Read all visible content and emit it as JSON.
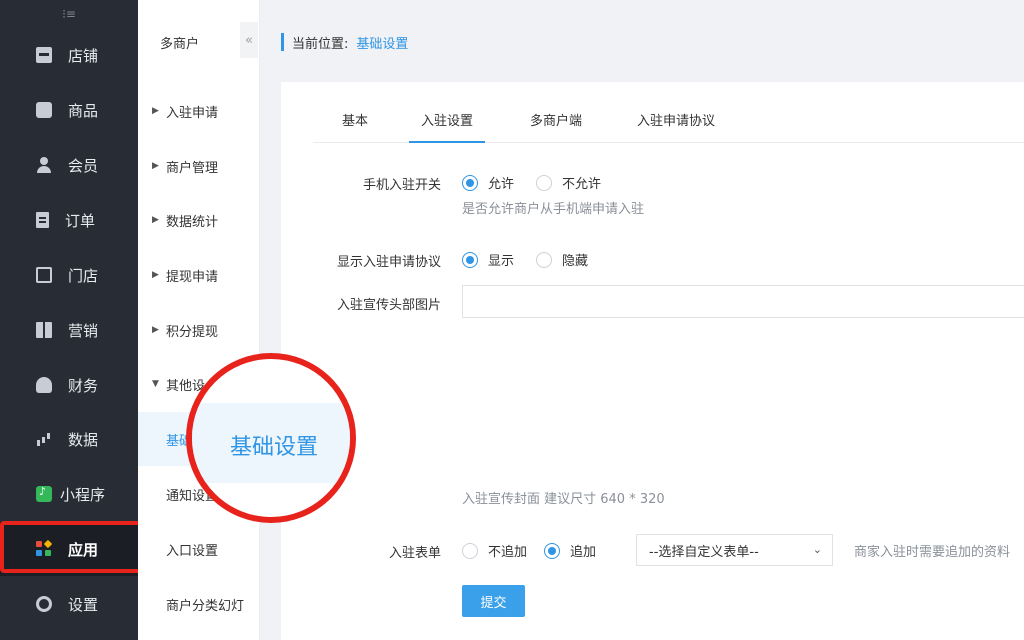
{
  "sidebar": {
    "items": [
      {
        "label": "店铺",
        "icon": "shop-icon"
      },
      {
        "label": "商品",
        "icon": "bag-icon"
      },
      {
        "label": "会员",
        "icon": "user-icon"
      },
      {
        "label": "订单",
        "icon": "order-icon"
      },
      {
        "label": "门店",
        "icon": "store-icon"
      },
      {
        "label": "营销",
        "icon": "gift-icon"
      },
      {
        "label": "财务",
        "icon": "money-bag-icon"
      },
      {
        "label": "数据",
        "icon": "bar-chart-icon"
      },
      {
        "label": "小程序",
        "icon": "mini-program-icon"
      },
      {
        "label": "应用",
        "icon": "apps-icon"
      },
      {
        "label": "设置",
        "icon": "gear-icon"
      }
    ],
    "active": "应用"
  },
  "submenu": {
    "title": "多商户",
    "items": [
      {
        "label": "入驻申请"
      },
      {
        "label": "商户管理"
      },
      {
        "label": "数据统计"
      },
      {
        "label": "提现申请"
      },
      {
        "label": "积分提现"
      },
      {
        "label": "其他设"
      },
      {
        "label": "基础"
      },
      {
        "label": "通知设置"
      },
      {
        "label": "入口设置"
      },
      {
        "label": "商户分类幻灯"
      }
    ],
    "collapse_glyph": "«"
  },
  "breadcrumb": {
    "prefix": "当前位置:",
    "current": "基础设置"
  },
  "tabs": [
    {
      "label": "基本"
    },
    {
      "label": "入驻设置"
    },
    {
      "label": "多商户端"
    },
    {
      "label": "入驻申请协议"
    }
  ],
  "active_tab": "入驻设置",
  "form": {
    "mobile_switch": {
      "label": "手机入驻开关",
      "options": [
        "允许",
        "不允许"
      ],
      "selected": "允许",
      "hint": "是否允许商户从手机端申请入驻"
    },
    "show_agreement": {
      "label": "显示入驻申请协议",
      "options": [
        "显示",
        "隐藏"
      ],
      "selected": "显示"
    },
    "header_image": {
      "label": "入驻宣传头部图片",
      "value": "",
      "hint": "入驻宣传封面 建议尺寸 640 * 320"
    },
    "signup_form": {
      "label": "入驻表单",
      "options": [
        "不追加",
        "追加"
      ],
      "selected": "追加",
      "select_value": "--选择自定义表单--",
      "hint": "商家入驻时需要追加的资料"
    },
    "submit_label": "提交"
  },
  "callout": {
    "text": "基础设置"
  },
  "colors": {
    "accent": "#2f95e4",
    "sidebar_bg": "#282c35",
    "highlight": "#e8231c"
  }
}
